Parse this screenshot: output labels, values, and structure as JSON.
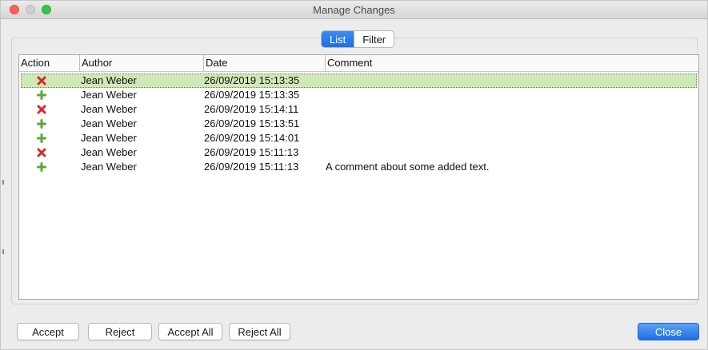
{
  "window": {
    "title": "Manage Changes"
  },
  "tabs": [
    {
      "label": "List",
      "active": true
    },
    {
      "label": "Filter",
      "active": false
    }
  ],
  "table": {
    "columns": [
      "Action",
      "Author",
      "Date",
      "Comment"
    ],
    "rows": [
      {
        "action": "delete-icon",
        "author": "Jean Weber",
        "date": "26/09/2019 15:13:35",
        "comment": "",
        "selected": true
      },
      {
        "action": "add-icon",
        "author": "Jean Weber",
        "date": "26/09/2019 15:13:35",
        "comment": ""
      },
      {
        "action": "delete-icon",
        "author": "Jean Weber",
        "date": "26/09/2019 15:14:11",
        "comment": ""
      },
      {
        "action": "add-icon",
        "author": "Jean Weber",
        "date": "26/09/2019 15:13:51",
        "comment": ""
      },
      {
        "action": "add-icon",
        "author": "Jean Weber",
        "date": "26/09/2019 15:14:01",
        "comment": ""
      },
      {
        "action": "delete-icon",
        "author": "Jean Weber",
        "date": "26/09/2019 15:11:13",
        "comment": ""
      },
      {
        "action": "add-icon",
        "author": "Jean Weber",
        "date": "26/09/2019 15:11:13",
        "comment": "A comment about some added text."
      }
    ]
  },
  "buttons": {
    "accept": "Accept",
    "reject": "Reject",
    "accept_all": "Accept All",
    "reject_all": "Reject All",
    "close": "Close"
  },
  "colors": {
    "selected_row": "#cfe8b8",
    "primary_button": "#1f6fe0",
    "delete_icon": "#d42a2a",
    "add_icon": "#5aa83a"
  }
}
